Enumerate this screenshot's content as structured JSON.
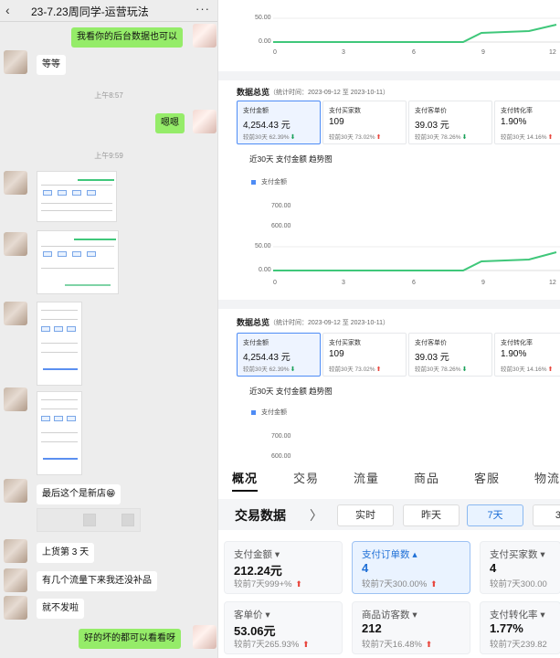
{
  "chat": {
    "title": "23-7.23周同学-运营玩法",
    "back_icon": "‹",
    "more_icon": "···",
    "messages": [
      {
        "text": "我看你的后台数据也可以"
      },
      {
        "text": "等等"
      },
      {
        "text": "嗯嗯"
      },
      {
        "text": "最后这个是新店😁"
      },
      {
        "text": "上货第 3 天"
      },
      {
        "text": "有几个流量下来我还没补品"
      },
      {
        "text": "就不发啦"
      },
      {
        "text": "好的坏的都可以看看呀"
      }
    ],
    "times": [
      "上午8:57",
      "上午9:59"
    ]
  },
  "dashboard": {
    "panel_title": "数据总览",
    "period": "（统计时间：2023-09-12 至 2023-10-11）",
    "cards": [
      {
        "label": "支付金额",
        "value": "4,254.43 元",
        "compare": "较前30天 62.39%",
        "dir": "down"
      },
      {
        "label": "支付买家数",
        "value": "109",
        "compare": "较前30天 73.02%",
        "dir": "up"
      },
      {
        "label": "支付客单价",
        "value": "39.03 元",
        "compare": "较前30天 78.26%",
        "dir": "down"
      },
      {
        "label": "支付转化率",
        "value": "1.90%",
        "compare": "较前30天 14.16%",
        "dir": "up"
      }
    ],
    "trend_title": "近30天 支付金额 趋势图",
    "legend": "支付金额",
    "y_ticks_top": [
      "50.00",
      "0.00"
    ],
    "x_ticks": [
      "0",
      "3",
      "6",
      "9",
      "12"
    ],
    "y_ticks_bottom": [
      "700.00",
      "600.00"
    ],
    "down_arrow": "⬇",
    "up_arrow": "⬆",
    "line_color": "#3fc77a"
  },
  "app": {
    "tabs": [
      "概况",
      "交易",
      "流量",
      "商品",
      "客服",
      "物流"
    ],
    "section_title": "交易数据",
    "chevron": "〉",
    "ranges": [
      "实时",
      "昨天",
      "7天",
      "30"
    ],
    "cards": [
      {
        "label": "支付金额 ▾",
        "value": "212.24元",
        "compare": "较前7天999+%",
        "arrow": "⬆"
      },
      {
        "label": "支付订单数 ▴",
        "value": "4",
        "compare": "较前7天300.00%",
        "arrow": "⬆"
      },
      {
        "label": "支付买家数 ▾",
        "value": "4",
        "compare": "较前7天300.00",
        "arrow": ""
      },
      {
        "label": "客单价 ▾",
        "value": "53.06元",
        "compare": "较前7天265.93%",
        "arrow": "⬆"
      },
      {
        "label": "商品访客数 ▾",
        "value": "212",
        "compare": "较前7天16.48%",
        "arrow": "⬆"
      },
      {
        "label": "支付转化率 ▾",
        "value": "1.77%",
        "compare": "较前7天239.82",
        "arrow": ""
      }
    ]
  }
}
